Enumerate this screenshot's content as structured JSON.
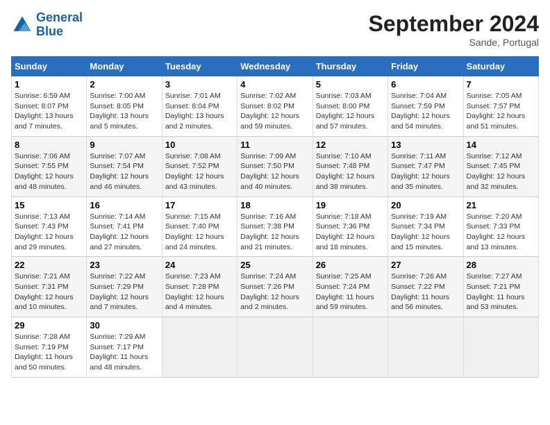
{
  "header": {
    "logo_line1": "General",
    "logo_line2": "Blue",
    "month": "September 2024",
    "location": "Sande, Portugal"
  },
  "days_of_week": [
    "Sunday",
    "Monday",
    "Tuesday",
    "Wednesday",
    "Thursday",
    "Friday",
    "Saturday"
  ],
  "weeks": [
    [
      {
        "day": 1,
        "lines": [
          "Sunrise: 6:59 AM",
          "Sunset: 8:07 PM",
          "Daylight: 13 hours",
          "and 7 minutes."
        ]
      },
      {
        "day": 2,
        "lines": [
          "Sunrise: 7:00 AM",
          "Sunset: 8:05 PM",
          "Daylight: 13 hours",
          "and 5 minutes."
        ]
      },
      {
        "day": 3,
        "lines": [
          "Sunrise: 7:01 AM",
          "Sunset: 8:04 PM",
          "Daylight: 13 hours",
          "and 2 minutes."
        ]
      },
      {
        "day": 4,
        "lines": [
          "Sunrise: 7:02 AM",
          "Sunset: 8:02 PM",
          "Daylight: 12 hours",
          "and 59 minutes."
        ]
      },
      {
        "day": 5,
        "lines": [
          "Sunrise: 7:03 AM",
          "Sunset: 8:00 PM",
          "Daylight: 12 hours",
          "and 57 minutes."
        ]
      },
      {
        "day": 6,
        "lines": [
          "Sunrise: 7:04 AM",
          "Sunset: 7:59 PM",
          "Daylight: 12 hours",
          "and 54 minutes."
        ]
      },
      {
        "day": 7,
        "lines": [
          "Sunrise: 7:05 AM",
          "Sunset: 7:57 PM",
          "Daylight: 12 hours",
          "and 51 minutes."
        ]
      }
    ],
    [
      {
        "day": 8,
        "lines": [
          "Sunrise: 7:06 AM",
          "Sunset: 7:55 PM",
          "Daylight: 12 hours",
          "and 48 minutes."
        ]
      },
      {
        "day": 9,
        "lines": [
          "Sunrise: 7:07 AM",
          "Sunset: 7:54 PM",
          "Daylight: 12 hours",
          "and 46 minutes."
        ]
      },
      {
        "day": 10,
        "lines": [
          "Sunrise: 7:08 AM",
          "Sunset: 7:52 PM",
          "Daylight: 12 hours",
          "and 43 minutes."
        ]
      },
      {
        "day": 11,
        "lines": [
          "Sunrise: 7:09 AM",
          "Sunset: 7:50 PM",
          "Daylight: 12 hours",
          "and 40 minutes."
        ]
      },
      {
        "day": 12,
        "lines": [
          "Sunrise: 7:10 AM",
          "Sunset: 7:48 PM",
          "Daylight: 12 hours",
          "and 38 minutes."
        ]
      },
      {
        "day": 13,
        "lines": [
          "Sunrise: 7:11 AM",
          "Sunset: 7:47 PM",
          "Daylight: 12 hours",
          "and 35 minutes."
        ]
      },
      {
        "day": 14,
        "lines": [
          "Sunrise: 7:12 AM",
          "Sunset: 7:45 PM",
          "Daylight: 12 hours",
          "and 32 minutes."
        ]
      }
    ],
    [
      {
        "day": 15,
        "lines": [
          "Sunrise: 7:13 AM",
          "Sunset: 7:43 PM",
          "Daylight: 12 hours",
          "and 29 minutes."
        ]
      },
      {
        "day": 16,
        "lines": [
          "Sunrise: 7:14 AM",
          "Sunset: 7:41 PM",
          "Daylight: 12 hours",
          "and 27 minutes."
        ]
      },
      {
        "day": 17,
        "lines": [
          "Sunrise: 7:15 AM",
          "Sunset: 7:40 PM",
          "Daylight: 12 hours",
          "and 24 minutes."
        ]
      },
      {
        "day": 18,
        "lines": [
          "Sunrise: 7:16 AM",
          "Sunset: 7:38 PM",
          "Daylight: 12 hours",
          "and 21 minutes."
        ]
      },
      {
        "day": 19,
        "lines": [
          "Sunrise: 7:18 AM",
          "Sunset: 7:36 PM",
          "Daylight: 12 hours",
          "and 18 minutes."
        ]
      },
      {
        "day": 20,
        "lines": [
          "Sunrise: 7:19 AM",
          "Sunset: 7:34 PM",
          "Daylight: 12 hours",
          "and 15 minutes."
        ]
      },
      {
        "day": 21,
        "lines": [
          "Sunrise: 7:20 AM",
          "Sunset: 7:33 PM",
          "Daylight: 12 hours",
          "and 13 minutes."
        ]
      }
    ],
    [
      {
        "day": 22,
        "lines": [
          "Sunrise: 7:21 AM",
          "Sunset: 7:31 PM",
          "Daylight: 12 hours",
          "and 10 minutes."
        ]
      },
      {
        "day": 23,
        "lines": [
          "Sunrise: 7:22 AM",
          "Sunset: 7:29 PM",
          "Daylight: 12 hours",
          "and 7 minutes."
        ]
      },
      {
        "day": 24,
        "lines": [
          "Sunrise: 7:23 AM",
          "Sunset: 7:28 PM",
          "Daylight: 12 hours",
          "and 4 minutes."
        ]
      },
      {
        "day": 25,
        "lines": [
          "Sunrise: 7:24 AM",
          "Sunset: 7:26 PM",
          "Daylight: 12 hours",
          "and 2 minutes."
        ]
      },
      {
        "day": 26,
        "lines": [
          "Sunrise: 7:25 AM",
          "Sunset: 7:24 PM",
          "Daylight: 11 hours",
          "and 59 minutes."
        ]
      },
      {
        "day": 27,
        "lines": [
          "Sunrise: 7:26 AM",
          "Sunset: 7:22 PM",
          "Daylight: 11 hours",
          "and 56 minutes."
        ]
      },
      {
        "day": 28,
        "lines": [
          "Sunrise: 7:27 AM",
          "Sunset: 7:21 PM",
          "Daylight: 11 hours",
          "and 53 minutes."
        ]
      }
    ],
    [
      {
        "day": 29,
        "lines": [
          "Sunrise: 7:28 AM",
          "Sunset: 7:19 PM",
          "Daylight: 11 hours",
          "and 50 minutes."
        ]
      },
      {
        "day": 30,
        "lines": [
          "Sunrise: 7:29 AM",
          "Sunset: 7:17 PM",
          "Daylight: 11 hours",
          "and 48 minutes."
        ]
      },
      null,
      null,
      null,
      null,
      null
    ]
  ]
}
